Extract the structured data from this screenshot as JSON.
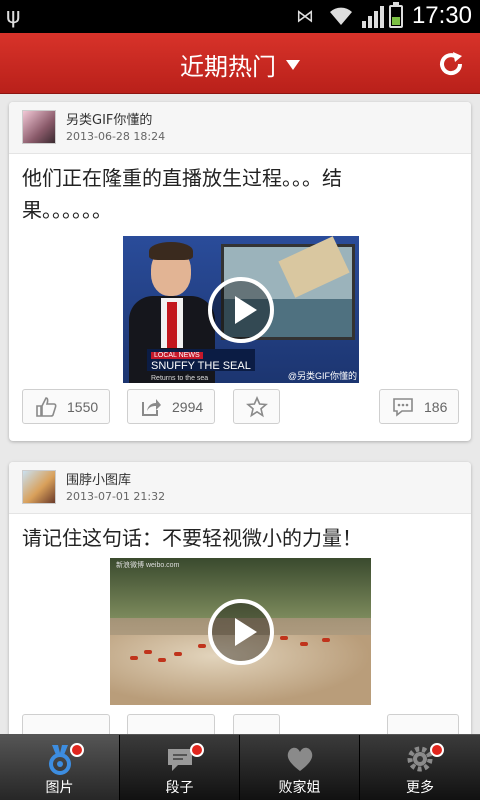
{
  "status_bar": {
    "time": "17:30"
  },
  "header": {
    "title": "近期热门"
  },
  "feed": [
    {
      "user": "另类GIF你懂的",
      "date": "2013-06-28 18:24",
      "text": "他们正在隆重的直播放生过程。。。结果。。。。。。",
      "media": {
        "caption_tag": "LOCAL NEWS",
        "caption_title": "SNUFFY THE SEAL",
        "caption_sub": "Returns to the sea",
        "watermark": "@另类GIF你懂的"
      },
      "likes": "1550",
      "shares": "2994",
      "comments": "186"
    },
    {
      "user": "围脖小图库",
      "date": "2013-07-01 21:32",
      "text": "请记住这句话：不要轻视微小的力量！",
      "media": {
        "watermark": "新浪微博 weibo.com"
      }
    }
  ],
  "tabs": [
    {
      "label": "图片",
      "icon": "picture-medal-icon",
      "active": true
    },
    {
      "label": "段子",
      "icon": "speech-bubble-icon"
    },
    {
      "label": "败家姐",
      "icon": "heart-icon"
    },
    {
      "label": "更多",
      "icon": "gear-icon"
    }
  ],
  "colors": {
    "header": "#c8271f",
    "tab_dot": "#e0251d"
  }
}
